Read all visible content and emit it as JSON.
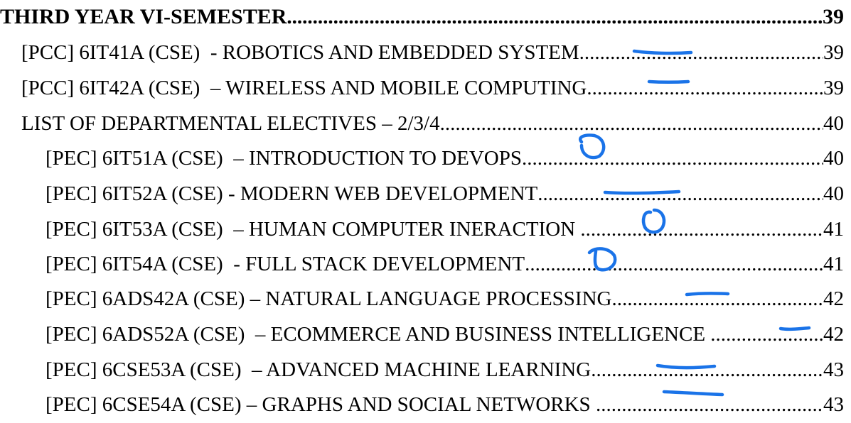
{
  "toc": {
    "heading": {
      "text": "THIRD YEAR VI-SEMESTER",
      "page": "39"
    },
    "entries": [
      {
        "text": "[PCC] 6IT41A (CSE)  - ROBOTICS AND EMBEDDED SYSTEM",
        "page": "39"
      },
      {
        "text": "[PCC] 6IT42A (CSE)  – WIRELESS AND MOBILE COMPUTING",
        "page": "39"
      },
      {
        "text": "LIST OF DEPARTMENTAL ELECTIVES – 2/3/4",
        "page": "40"
      },
      {
        "text": "[PEC] 6IT51A (CSE)  – INTRODUCTION TO DEVOPS",
        "page": "40"
      },
      {
        "text": "[PEC] 6IT52A (CSE) - MODERN WEB DEVELOPMENT",
        "page": "40"
      },
      {
        "text": "[PEC] 6IT53A (CSE)  – HUMAN COMPUTER INERACTION ",
        "page": "41"
      },
      {
        "text": "[PEC] 6IT54A (CSE)  - FULL STACK DEVELOPMENT",
        "page": "41"
      },
      {
        "text": "[PEC] 6ADS42A (CSE) – NATURAL LANGUAGE PROCESSING",
        "page": "42"
      },
      {
        "text": "[PEC] 6ADS52A (CSE)  – ECOMMERCE AND BUSINESS INTELLIGENCE ",
        "page": "42"
      },
      {
        "text": "[PEC] 6CSE53A (CSE)  – ADVANCED MACHINE LEARNING",
        "page": "43"
      },
      {
        "text": "[PEC] 6CSE54A (CSE) – GRAPHS AND SOCIAL NETWORKS ",
        "page": "43"
      }
    ]
  },
  "colors": {
    "text": "#000000",
    "annotation_ink": "#1a73e8",
    "background": "#ffffff"
  }
}
